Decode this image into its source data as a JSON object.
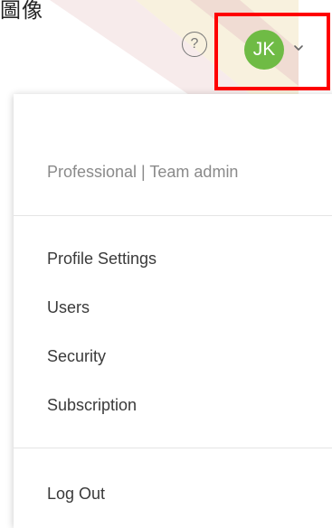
{
  "header": {
    "corner_label": "圖像",
    "help_button_label": "?",
    "avatar_initials": "JK",
    "avatar_color": "#6fbb45",
    "highlight_color": "#ff0000"
  },
  "dropdown": {
    "role_label": "Professional | Team admin",
    "items": [
      {
        "label": "Profile Settings"
      },
      {
        "label": "Users"
      },
      {
        "label": "Security"
      },
      {
        "label": "Subscription"
      }
    ],
    "logout_label": "Log Out"
  },
  "icons": {
    "help": "question-circle-icon",
    "chevron": "chevron-down-icon"
  }
}
